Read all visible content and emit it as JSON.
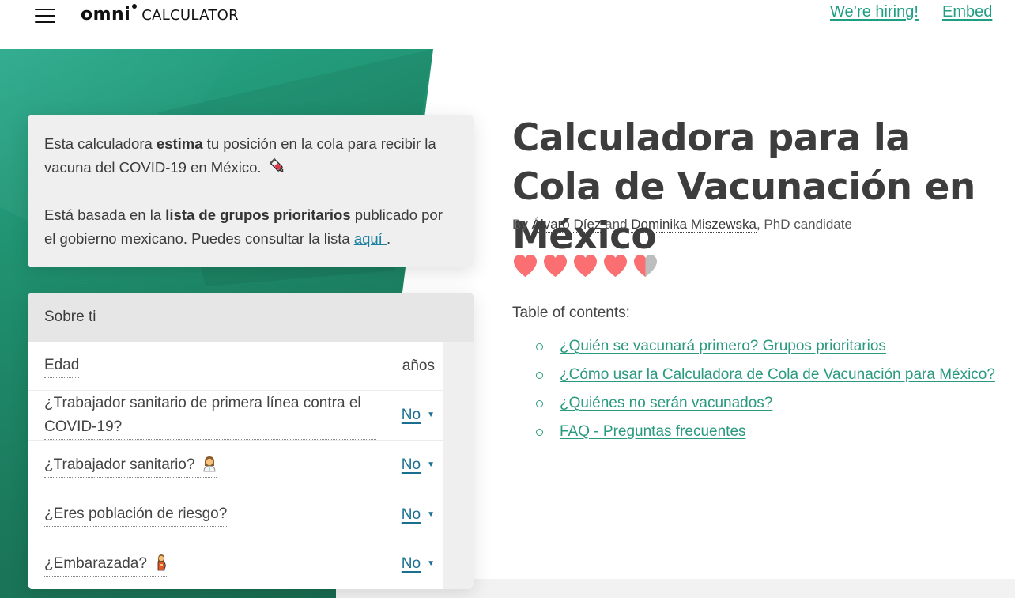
{
  "header": {
    "logo_primary": "omni",
    "logo_secondary": "CALCULATOR",
    "links": [
      {
        "label": "We’re hiring!"
      },
      {
        "label": "Embed"
      }
    ]
  },
  "intro": {
    "p1_before": "Esta calculadora ",
    "p1_bold": "estima",
    "p1_after": " tu posición en la cola para recibir la vacuna del COVID-19 en México.",
    "p1_emoji": "syringe",
    "p2_before": "Está basada en la ",
    "p2_bold": "lista de grupos prioritarios",
    "p2_after": " publicado por el gobierno mexicano. Puedes consultar la lista ",
    "p2_link": "aquí ",
    "p2_end": "."
  },
  "calculator": {
    "section_title": "Sobre ti",
    "rows": [
      {
        "label": "Edad",
        "unit": "años",
        "value": ""
      },
      {
        "label": "¿Trabajador sanitario de primera línea contra el COVID-19?",
        "value": "No"
      },
      {
        "label": "¿Trabajador sanitario?",
        "emoji": "health-worker",
        "value": "No"
      },
      {
        "label": "¿Eres población de riesgo?",
        "value": "No"
      },
      {
        "label": "¿Embarazada?",
        "emoji": "pregnant-woman",
        "value": "No"
      }
    ]
  },
  "article": {
    "title": "Calculadora para la Cola de Vacunación en México",
    "by": "By ",
    "author1": "Álvaro Díez",
    "and": " and ",
    "author2": "Dominika Miszewska",
    "author2_suffix": ", PhD candidate",
    "rating": {
      "value": 4.5,
      "max": 5,
      "color_filled": "#fb6f72",
      "color_empty": "#bdbdbd"
    },
    "toc_title": "Table of contents:",
    "toc": [
      {
        "label": "¿Quién se vacunará primero? Grupos prioritarios"
      },
      {
        "label": "¿Cómo usar la Calculadora de Cola de Vacunación para México?"
      },
      {
        "label": "¿Quiénes no serán vacunados?"
      },
      {
        "label": "FAQ - Preguntas frecuentes"
      }
    ]
  },
  "colors": {
    "brand_green": "#1e9e82",
    "link_blue": "#1a6f91",
    "hero_green": "#1f8e6c"
  }
}
